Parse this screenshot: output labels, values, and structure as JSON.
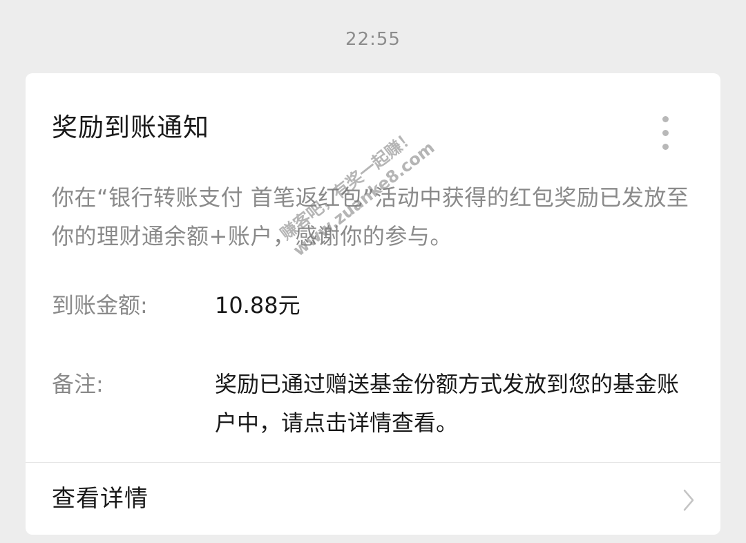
{
  "timestamp": "22:55",
  "card": {
    "title": "奖励到账通知",
    "more_icon": "more-vertical-icon",
    "description": "你在“银行转账支付 首笔返红包”活动中获得的红包奖励已发放至你的理财通余额+账户，感谢你的参与。",
    "amount": {
      "label": "到账金额:",
      "value": "10.88元"
    },
    "remark": {
      "label": "备注:",
      "value": "奖励已通过赠送基金份额方式发放到您的基金账户中，请点击详情查看。"
    },
    "detail_link": {
      "label": "查看详情",
      "icon": "chevron-right-icon"
    }
  },
  "watermark": {
    "line1": "赚客吧，有奖一起赚！",
    "line2": "www.zuanke8.com"
  },
  "colors": {
    "background": "#ededed",
    "card": "#ffffff",
    "primary_text": "#191919",
    "secondary_text": "#8a8a8a",
    "timestamp": "#8c8c8c"
  }
}
